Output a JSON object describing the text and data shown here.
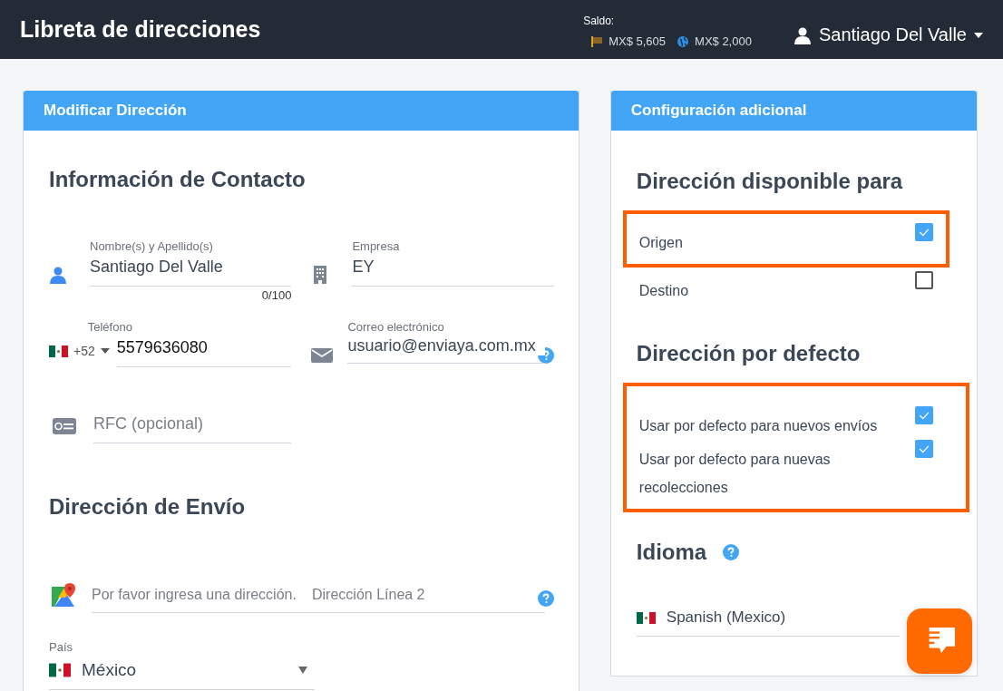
{
  "header": {
    "title": "Libreta de direcciones",
    "balance_label": "Saldo:",
    "balances": [
      {
        "kind": "flag",
        "amount": "MX$ 5,605"
      },
      {
        "kind": "globe",
        "amount": "MX$ 2,000"
      }
    ],
    "user": "Santiago Del Valle"
  },
  "left_panel": {
    "title": "Modificar Dirección",
    "contact": {
      "heading": "Información de Contacto",
      "name_field": {
        "label": "Nombre(s) y Apellido(s)",
        "value": "Santiago Del Valle",
        "counter": "0/100"
      },
      "company_field": {
        "label": "Empresa",
        "value": "EY"
      },
      "phone_field": {
        "label": "Teléfono",
        "code": "+52",
        "value": "5579636080"
      },
      "email_field": {
        "label": "Correo electrónico",
        "value": "usuario@enviaya.com.mx"
      },
      "rfc_field": {
        "placeholder": "RFC (opcional)"
      }
    },
    "shipping": {
      "heading": "Dirección de Envío",
      "address_field": {
        "placeholder": "Por favor ingresa una dirección."
      },
      "line2_field": {
        "placeholder": "Dirección Línea 2"
      },
      "country_field": {
        "label": "País",
        "value": "México"
      }
    }
  },
  "right_panel": {
    "title": "Configuración adicional",
    "groups": [
      {
        "heading": "Dirección disponible para",
        "options": [
          {
            "label": "Origen",
            "checked": true,
            "highlighted": true
          },
          {
            "label": "Destino",
            "checked": false,
            "highlighted": false
          }
        ]
      },
      {
        "heading": "Dirección por defecto",
        "options": [
          {
            "label": "Usar por defecto para nuevos envíos",
            "checked": true,
            "highlighted": true
          },
          {
            "label": "Usar por defecto para nuevas recolecciones",
            "checked": true,
            "highlighted": true
          }
        ]
      }
    ],
    "language": {
      "heading": "Idioma",
      "value": "Spanish (Mexico)"
    }
  }
}
